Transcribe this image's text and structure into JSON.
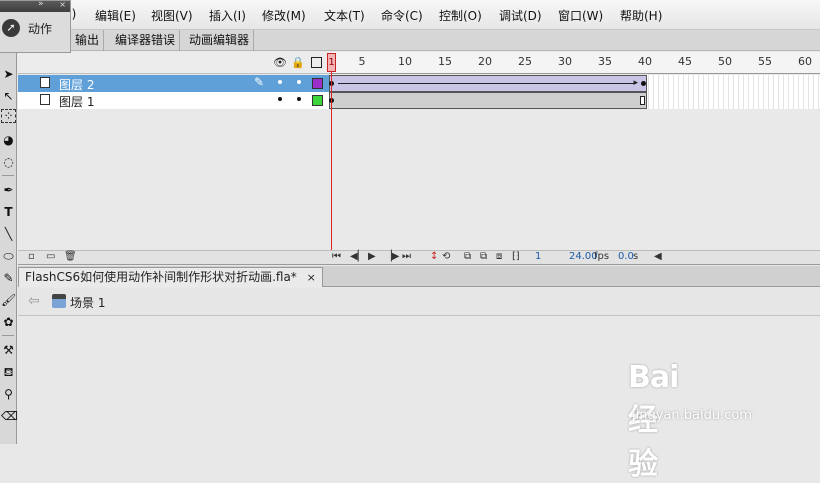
{
  "menubar": {
    "items": [
      "(F)",
      "编辑(E)",
      "视图(V)",
      "插入(I)",
      "修改(M)",
      "文本(T)",
      "命令(C)",
      "控制(O)",
      "调试(D)",
      "窗口(W)",
      "帮助(H)"
    ]
  },
  "action_panel": {
    "label": "动作",
    "arrows": "»",
    "close": "×"
  },
  "panel_tabs": [
    "输出",
    "编译器错误",
    "动画编辑器"
  ],
  "timeline": {
    "header_icons": [
      "eye-icon",
      "lock-icon",
      "outline-icon"
    ],
    "ruler": [
      "1",
      "5",
      "10",
      "15",
      "20",
      "25",
      "30",
      "35",
      "40",
      "45",
      "50",
      "55",
      "60"
    ],
    "current_frame": "1",
    "layers": [
      {
        "name": "图层 2",
        "selected": true,
        "color": "#9b30c8"
      },
      {
        "name": "图层 1",
        "selected": false,
        "color": "#3cd63c"
      }
    ],
    "footer": {
      "frame": "1",
      "fps": "24.00",
      "fps_unit": "fps",
      "time": "0.0",
      "time_unit": "s"
    }
  },
  "document": {
    "tab_title": "FlashCS6如何使用动作补间制作形状对折动画.fla*",
    "close": "×",
    "scene": "场景 1"
  },
  "watermark": {
    "brand": "Bai  经验",
    "url": "jingyan.baidu.com"
  },
  "colors": {
    "selected_layer": "#5fa0d8",
    "playhead": "#cc2222",
    "link_blue": "#1d5ca8"
  }
}
